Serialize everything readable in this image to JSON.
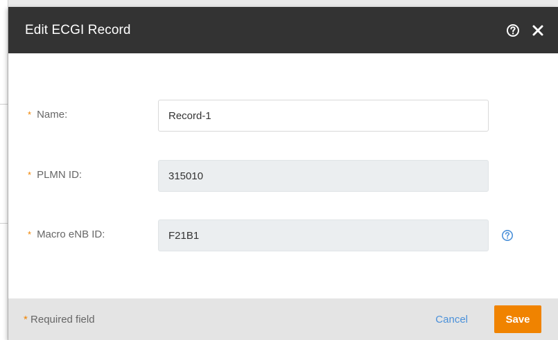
{
  "dialog": {
    "title": "Edit ECGI Record",
    "help_icon": "help-circle-icon",
    "close_icon": "close-icon"
  },
  "form": {
    "fields": [
      {
        "label": "Name:",
        "value": "Record-1",
        "required": true,
        "editable": true
      },
      {
        "label": "PLMN ID:",
        "value": "315010",
        "required": true,
        "editable": false
      },
      {
        "label": "Macro eNB ID:",
        "value": "F21B1",
        "required": true,
        "editable": false,
        "help_icon": "help-circle-icon"
      }
    ],
    "required_marker": "*"
  },
  "footer": {
    "required_note": "Required field",
    "cancel_label": "Cancel",
    "save_label": "Save"
  },
  "colors": {
    "header_bg": "#333333",
    "accent": "#f08300",
    "link": "#4a90d9",
    "footer_bg": "#e4e4e4",
    "disabled_field_bg": "#ebeef0"
  }
}
